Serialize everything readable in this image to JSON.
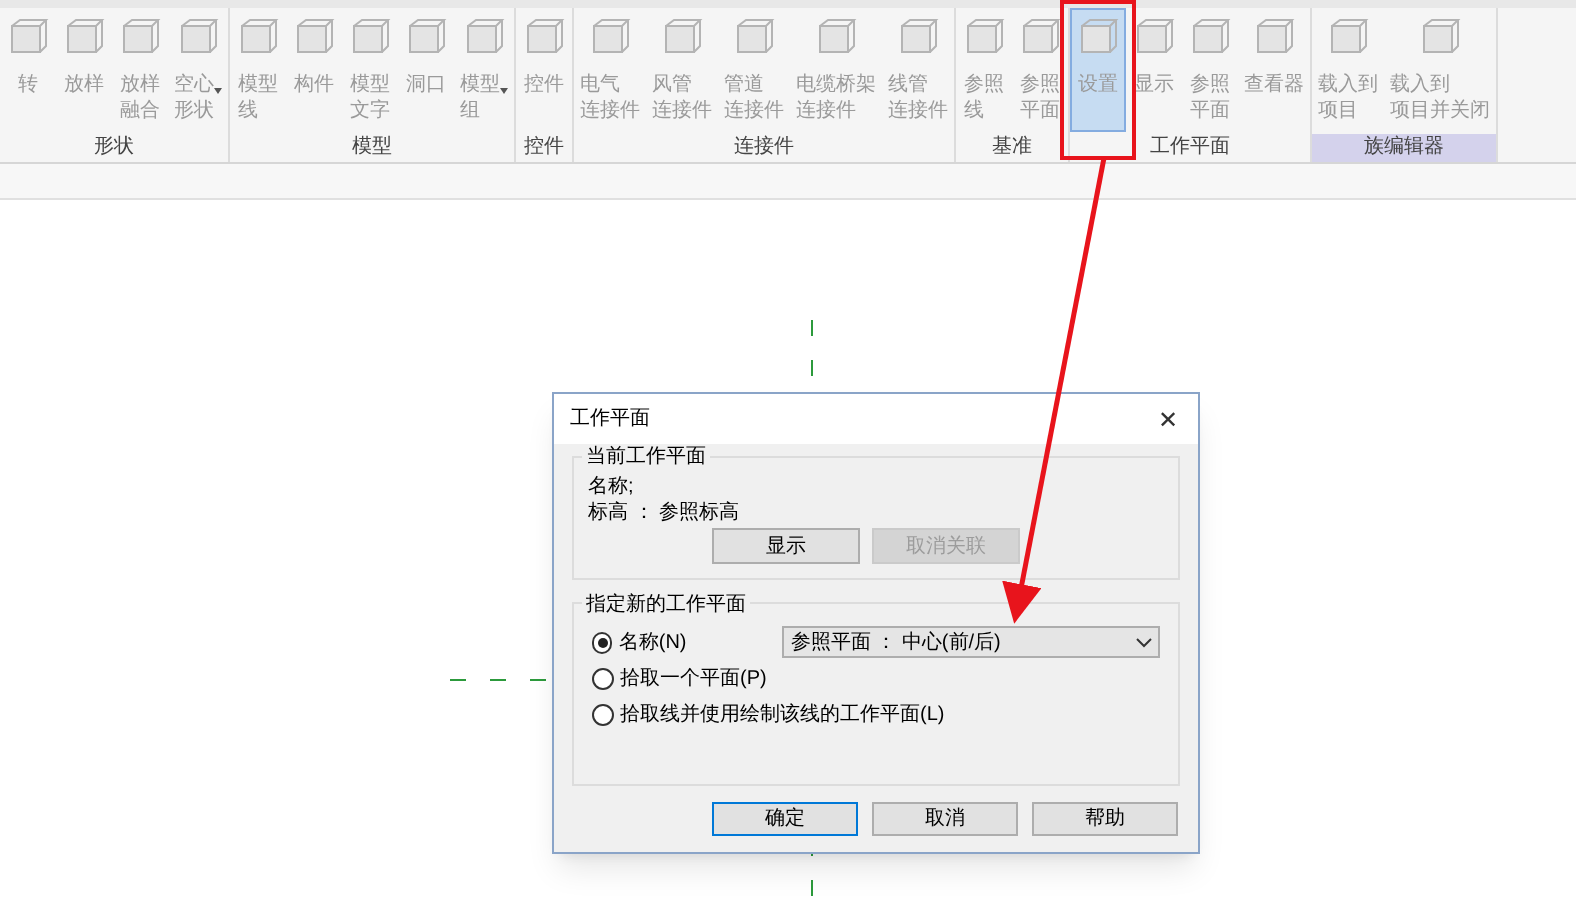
{
  "ribbon": {
    "panels": [
      {
        "label": "形状",
        "buttons": [
          {
            "lines": [
              "转"
            ],
            "selected": false
          },
          {
            "lines": [
              "放样"
            ],
            "selected": false
          },
          {
            "lines": [
              "放样",
              "融合"
            ],
            "selected": false
          },
          {
            "lines": [
              "空心",
              "形状"
            ],
            "dropdown": true,
            "selected": false
          }
        ]
      },
      {
        "label": "模型",
        "buttons": [
          {
            "lines": [
              "模型",
              "线"
            ],
            "selected": false
          },
          {
            "lines": [
              "构件"
            ],
            "selected": false
          },
          {
            "lines": [
              "模型",
              "文字"
            ],
            "selected": false
          },
          {
            "lines": [
              "洞口"
            ],
            "selected": false
          },
          {
            "lines": [
              "模型",
              "组"
            ],
            "dropdown": true,
            "selected": false
          }
        ]
      },
      {
        "label": "控件",
        "buttons": [
          {
            "lines": [
              "控件"
            ],
            "selected": false
          }
        ]
      },
      {
        "label": "连接件",
        "buttons": [
          {
            "lines": [
              "电气",
              "连接件"
            ],
            "selected": false
          },
          {
            "lines": [
              "风管",
              "连接件"
            ],
            "selected": false
          },
          {
            "lines": [
              "管道",
              "连接件"
            ],
            "selected": false
          },
          {
            "lines": [
              "电缆桥架",
              "连接件"
            ],
            "selected": false
          },
          {
            "lines": [
              "线管",
              "连接件"
            ],
            "selected": false
          }
        ]
      },
      {
        "label": "基准",
        "buttons": [
          {
            "lines": [
              "参照",
              "线"
            ],
            "selected": false
          },
          {
            "lines": [
              "参照",
              "平面"
            ],
            "selected": false
          }
        ]
      },
      {
        "label": "工作平面",
        "buttons": [
          {
            "lines": [
              "设置"
            ],
            "selected": true
          },
          {
            "lines": [
              "显示"
            ],
            "selected": false
          },
          {
            "lines": [
              "参照",
              "平面"
            ],
            "selected": false
          },
          {
            "lines": [
              "查看器"
            ],
            "selected": false
          }
        ]
      },
      {
        "label": "族编辑器",
        "highlighted": true,
        "buttons": [
          {
            "lines": [
              "载入到",
              "项目"
            ],
            "selected": false
          },
          {
            "lines": [
              "载入到",
              "项目并关闭"
            ],
            "selected": false
          }
        ]
      }
    ]
  },
  "dialog": {
    "title": "工作平面",
    "close": "✕",
    "current": {
      "legend": "当前工作平面",
      "name_line": "名称;",
      "level_line": "标高 ： 参照标高",
      "buttons": [
        {
          "label": "显示",
          "disabled": false
        },
        {
          "label": "取消关联",
          "disabled": true
        }
      ]
    },
    "new": {
      "legend": "指定新的工作平面",
      "options": [
        {
          "label": "名称(N)",
          "selected": true,
          "value": "参照平面 ： 中心(前/后)"
        },
        {
          "label": "拾取一个平面(P)",
          "selected": false
        },
        {
          "label": "拾取线并使用绘制该线的工作平面(L)",
          "selected": false
        }
      ]
    },
    "footer": [
      {
        "label": "确定",
        "default": true
      },
      {
        "label": "取消",
        "default": false
      },
      {
        "label": "帮助",
        "default": false
      }
    ]
  }
}
